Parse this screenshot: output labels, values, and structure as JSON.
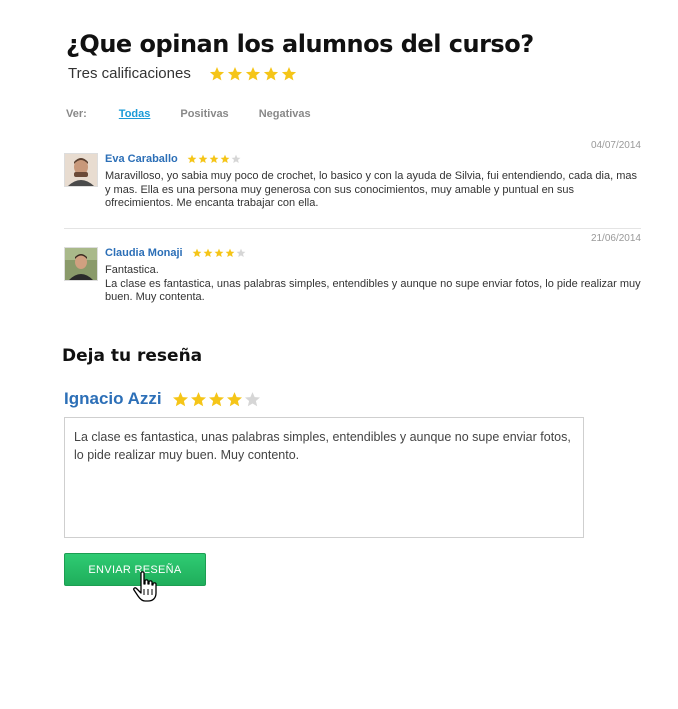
{
  "header": {
    "title": "¿Que opinan los alumnos del curso?",
    "subtitle": "Tres calificaciones",
    "rating": 5
  },
  "filters": {
    "label": "Ver:",
    "tabs": [
      {
        "label": "Todas",
        "active": true
      },
      {
        "label": "Positivas",
        "active": false
      },
      {
        "label": "Negativas",
        "active": false
      }
    ]
  },
  "reviews": [
    {
      "date": "04/07/2014",
      "name": "Eva Caraballo",
      "rating": 4,
      "text": "Maravilloso, yo sabia muy poco de crochet, lo basico y con la ayuda de Silvia, fui entendiendo, cada dia, mas y mas. Ella es una persona muy generosa con sus conocimientos, muy amable y puntual en sus ofrecimientos. Me encanta trabajar con ella."
    },
    {
      "date": "21/06/2014",
      "name": "Claudia Monaji",
      "rating": 4,
      "text_title": "Fantastica.",
      "text": "La clase es fantastica, unas palabras simples, entendibles y aunque no supe enviar fotos, lo pide realizar muy buen. Muy contenta."
    }
  ],
  "compose": {
    "section_title": "Deja tu reseña",
    "author": "Ignacio Azzi",
    "rating": 4,
    "text": "La clase es fantastica, unas palabras simples, entendibles y aunque no supe enviar fotos, lo pide realizar muy buen. Muy contento.",
    "button_label": "ENVIAR RESEÑA"
  },
  "colors": {
    "star_filled": "#f5c518",
    "star_empty": "#d6d6d6",
    "link_blue": "#2c6fb7",
    "tab_active": "#1a9bd7",
    "button_green": "#27ba66"
  }
}
